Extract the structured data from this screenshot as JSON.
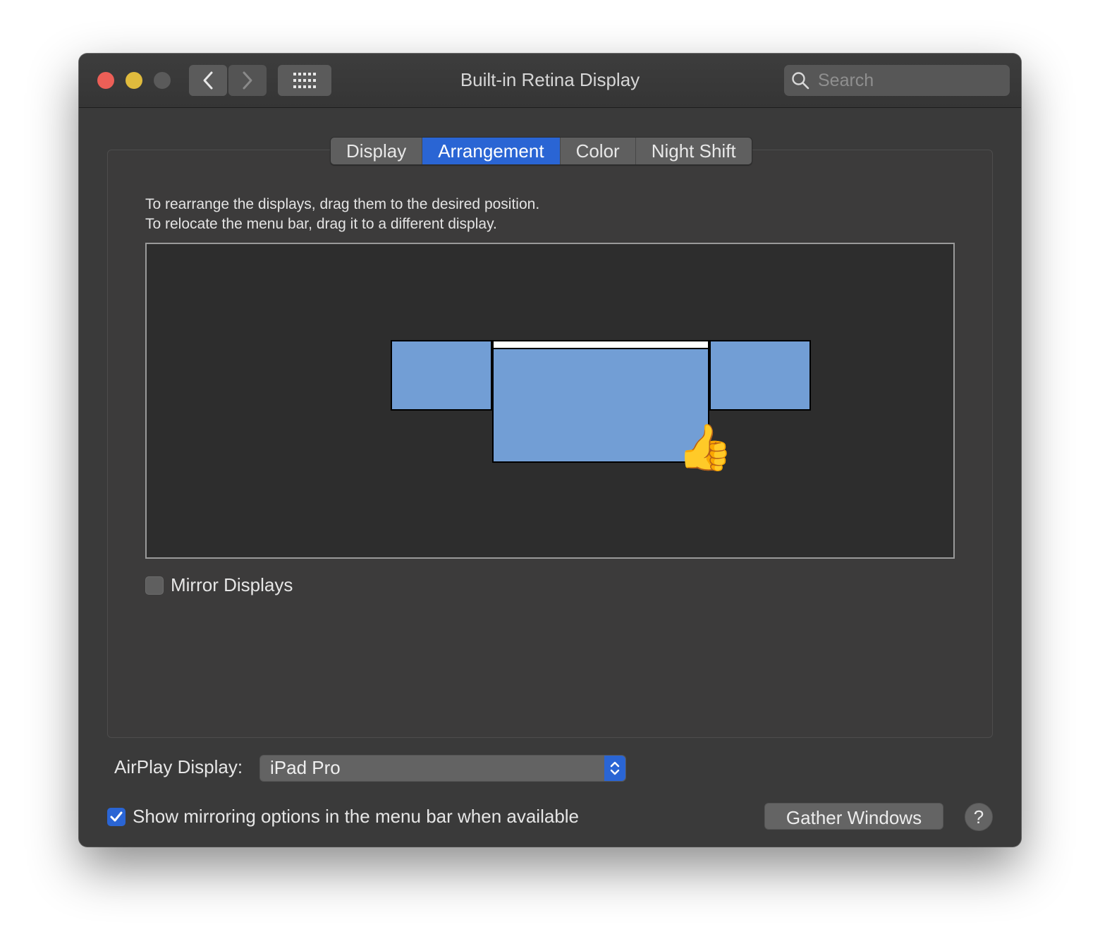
{
  "window": {
    "title": "Built-in Retina Display"
  },
  "toolbar": {
    "back_icon": "chevron-left-icon",
    "forward_icon": "chevron-right-icon",
    "grid_icon": "show-all-grid-icon"
  },
  "search": {
    "placeholder": "Search",
    "icon": "search-icon"
  },
  "tabs": [
    {
      "label": "Display",
      "active": false
    },
    {
      "label": "Arrangement",
      "active": true
    },
    {
      "label": "Color",
      "active": false
    },
    {
      "label": "Night Shift",
      "active": false
    }
  ],
  "instructions": {
    "line1": "To rearrange the displays, drag them to the desired position.",
    "line2": "To relocate the menu bar, drag it to a different display."
  },
  "arrangement": {
    "displays": [
      "left-display",
      "main-display",
      "right-display"
    ],
    "menu_bar_on": "main-display",
    "emoji": "👍"
  },
  "mirror_displays": {
    "label": "Mirror Displays",
    "checked": false
  },
  "airplay": {
    "label": "AirPlay Display:",
    "selected": "iPad Pro"
  },
  "show_mirroring": {
    "label": "Show mirroring options in the menu bar when available",
    "checked": true
  },
  "buttons": {
    "gather_windows": "Gather Windows",
    "help": "?"
  },
  "colors": {
    "accent": "#2a65d4",
    "display_fill": "#729ed5",
    "close": "#ec5f57",
    "minimize": "#e0bb3d"
  }
}
